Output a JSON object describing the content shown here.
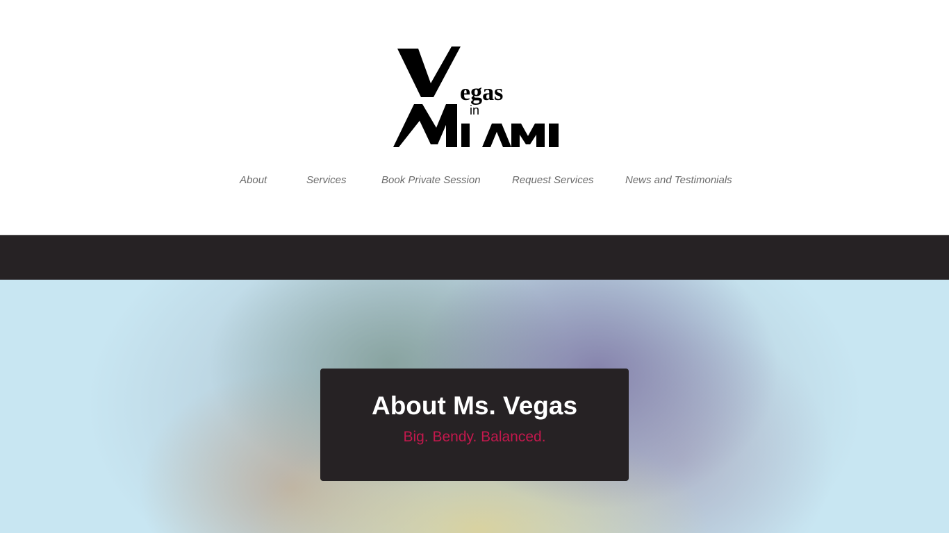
{
  "site": {
    "logo_text": [
      "Vegas",
      "in",
      "MIAMI"
    ]
  },
  "nav": {
    "items": [
      {
        "label": "About"
      },
      {
        "label": "Services"
      },
      {
        "label": "Book Private Session"
      },
      {
        "label": "Request Services"
      },
      {
        "label": "News and Testimonials"
      }
    ]
  },
  "hero": {
    "title": "About Ms. Vegas",
    "subtitle": "Big. Bendy. Balanced."
  },
  "colors": {
    "dark": "#262224",
    "accent": "#c4184d",
    "nav_text": "#6a6a6a",
    "sky": "#c8e6f2"
  }
}
